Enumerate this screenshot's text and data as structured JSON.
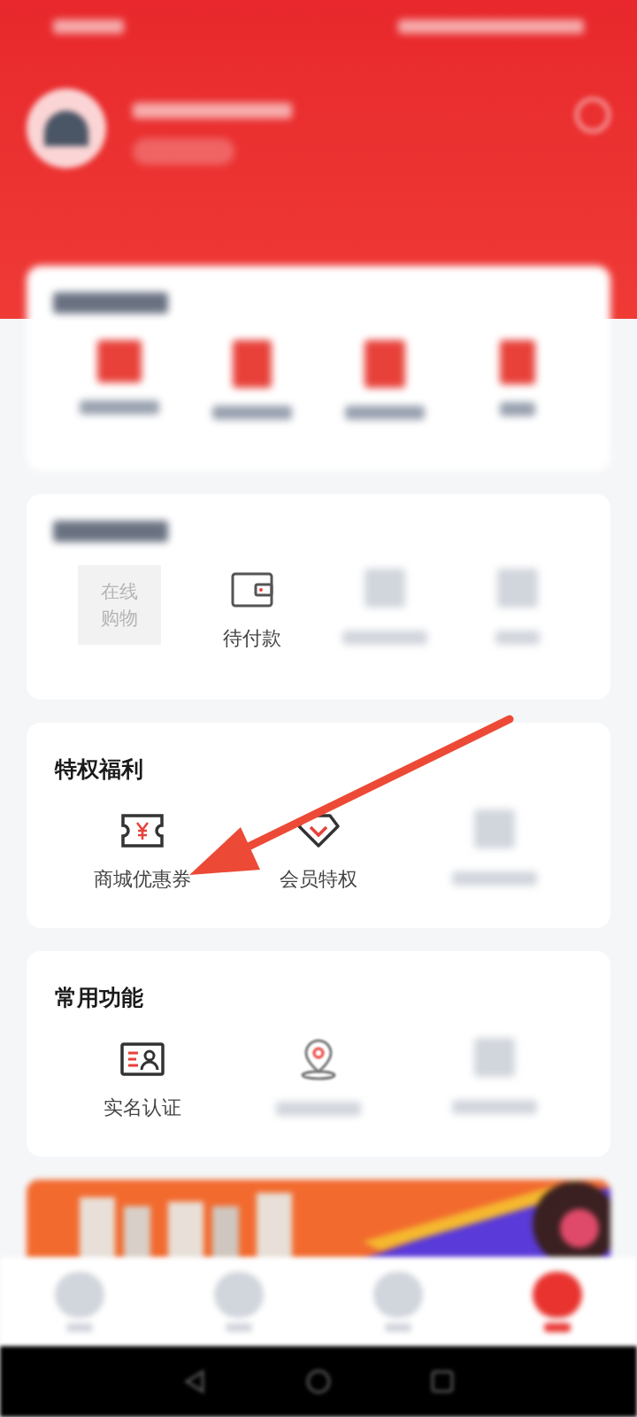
{
  "my_orders": {
    "items": [
      {
        "kind": "tile",
        "label": "在线购物"
      },
      {
        "kind": "icon",
        "label": "待付款"
      },
      {
        "kind": "blurred"
      },
      {
        "kind": "blurred"
      }
    ]
  },
  "privileges": {
    "title": "特权福利",
    "items": [
      {
        "kind": "icon",
        "label": "商城优惠券"
      },
      {
        "kind": "icon",
        "label": "会员特权"
      },
      {
        "kind": "blurred"
      }
    ]
  },
  "common": {
    "title": "常用功能",
    "items": [
      {
        "kind": "icon",
        "label": "实名认证"
      },
      {
        "kind": "icon_only"
      },
      {
        "kind": "blurred"
      }
    ]
  },
  "bottom_nav": [
    {
      "selected": false
    },
    {
      "selected": false
    },
    {
      "selected": false
    },
    {
      "selected": true
    }
  ]
}
